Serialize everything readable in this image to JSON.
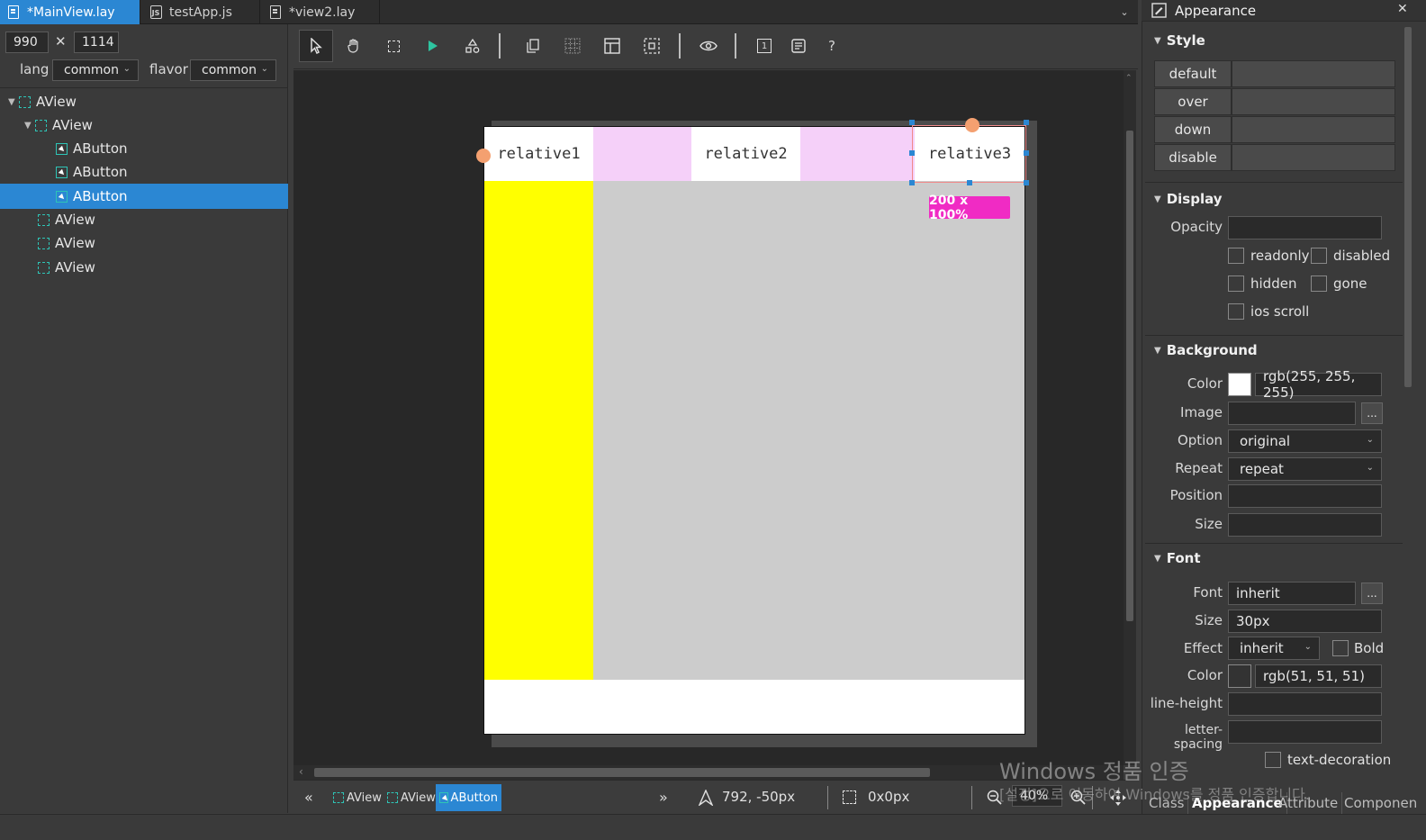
{
  "tabs": [
    {
      "label": "*MainView.lay",
      "icon": "document-icon",
      "active": true
    },
    {
      "label": "testApp.js",
      "icon": "js-file-icon",
      "active": false
    },
    {
      "label": "*view2.lay",
      "icon": "document-icon",
      "active": false
    }
  ],
  "left": {
    "width": "990",
    "times": "✕",
    "height": "1114",
    "lang_label": "lang",
    "lang_value": "common",
    "flavor_label": "flavor",
    "flavor_value": "common",
    "tree": [
      {
        "label": "AView",
        "type": "view",
        "caret": "▼"
      },
      {
        "label": "AView",
        "type": "view",
        "caret": "▼"
      },
      {
        "label": "AButton",
        "type": "button"
      },
      {
        "label": "AButton",
        "type": "button"
      },
      {
        "label": "AButton",
        "type": "button",
        "selected": true
      },
      {
        "label": "AView",
        "type": "view"
      },
      {
        "label": "AView",
        "type": "view"
      },
      {
        "label": "AView",
        "type": "view"
      }
    ]
  },
  "toolbar": {
    "help": "?",
    "page_badge": "1"
  },
  "canvas": {
    "button1": "relative1",
    "button2": "relative2",
    "button3": "relative3",
    "size_badge": "200 x 100%",
    "colors": {
      "bar": "#f5d0f9",
      "left": "#ffff00",
      "main": "#cccccc",
      "badge": "#f02bc4"
    }
  },
  "status": {
    "crumbs": [
      "AView",
      "AView",
      "AButton"
    ],
    "position": "792, -50px",
    "size": "0x0px",
    "zoom": "40%"
  },
  "right": {
    "title": "Appearance",
    "style": {
      "header": "Style",
      "states": [
        "default",
        "over",
        "down",
        "disable"
      ]
    },
    "display": {
      "header": "Display",
      "opacity_label": "Opacity",
      "readonly": "readonly",
      "disabled": "disabled",
      "hidden": "hidden",
      "gone": "gone",
      "ios_scroll": "ios scroll"
    },
    "background": {
      "header": "Background",
      "color_label": "Color",
      "color_value": "rgb(255, 255, 255)",
      "image_label": "Image",
      "option_label": "Option",
      "option_value": "original",
      "repeat_label": "Repeat",
      "repeat_value": "repeat",
      "position_label": "Position",
      "size_label": "Size",
      "dots": "..."
    },
    "font": {
      "header": "Font",
      "font_label": "Font",
      "font_value": "inherit",
      "size_label": "Size",
      "size_value": "30px",
      "effect_label": "Effect",
      "effect_value": "inherit",
      "bold": "Bold",
      "color_label": "Color",
      "color_value": "rgb(51, 51, 51)",
      "line_height_label": "line-height",
      "letter_spacing_label": "letter-spacing",
      "text_decoration": "text-decoration",
      "dots": "..."
    },
    "bottom_tabs": [
      "Class",
      "Appearance",
      "Attribute",
      "Componen"
    ]
  },
  "watermark": {
    "line1": "Windows 정품 인증",
    "line2": "[설정]으로 이동하여 Windows를 정품 인증합니다."
  }
}
